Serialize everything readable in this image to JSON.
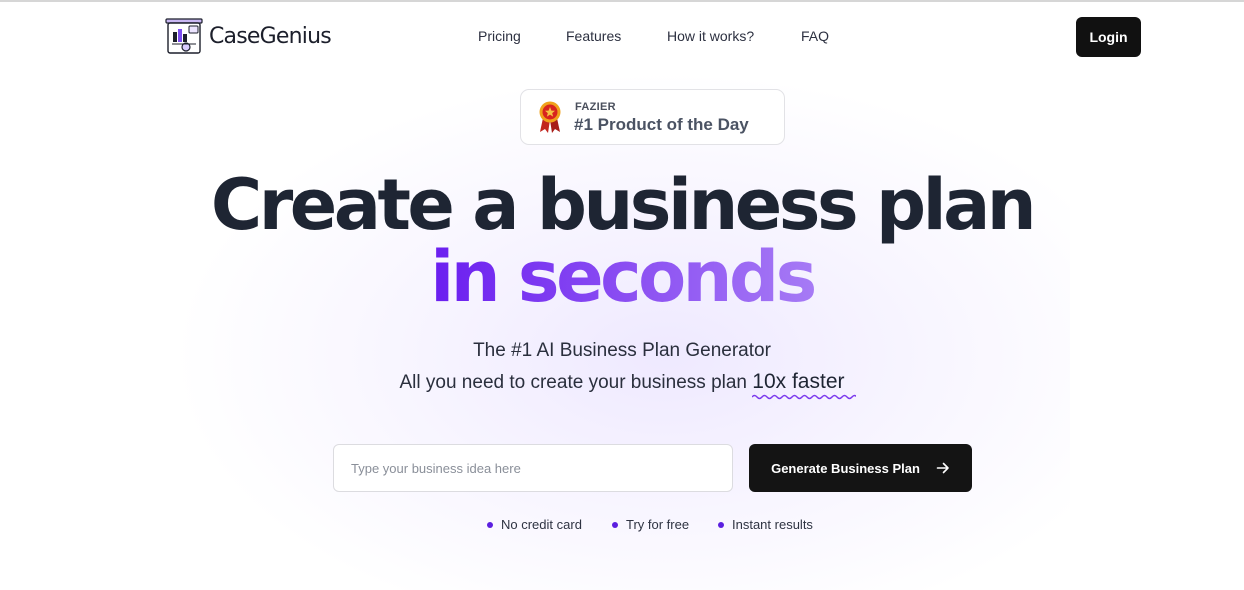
{
  "brand": {
    "name": "CaseGenius"
  },
  "nav": {
    "items": [
      "Pricing",
      "Features",
      "How it works?",
      "FAQ"
    ]
  },
  "header": {
    "login_label": "Login"
  },
  "badge": {
    "source": "FAZIER",
    "title": "#1 Product of the Day"
  },
  "hero": {
    "headline_line1": "Create a business plan",
    "headline_line2": "in seconds",
    "subtitle_line1": "The #1 AI Business Plan Generator",
    "subtitle_line2_prefix": "All you need to create your business plan ",
    "subtitle_line2_emphasis": "10x faster"
  },
  "form": {
    "placeholder": "Type your business idea here",
    "value": "",
    "button_label": "Generate Business Plan",
    "button_icon": "arrow-right-icon"
  },
  "perks": [
    "No credit card",
    "Try for free",
    "Instant results"
  ],
  "colors": {
    "accent_purple": "#6a1ef0",
    "dark_button": "#141414",
    "perk_dot": "#5b1fe0"
  }
}
